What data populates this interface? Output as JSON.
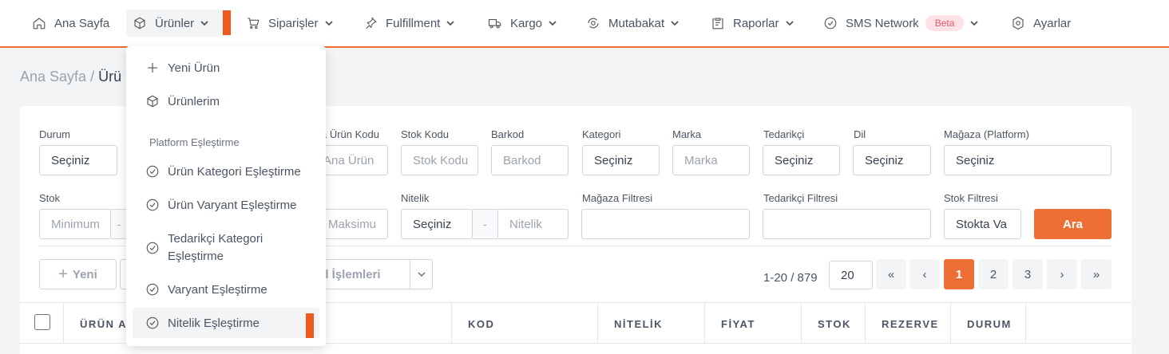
{
  "nav": {
    "home": "Ana Sayfa",
    "urunler": "Ürünler",
    "siparisler": "Siparişler",
    "fulfillment": "Fulfillment",
    "kargo": "Kargo",
    "mutabakat": "Mutabakat",
    "raporlar": "Raporlar",
    "sms": "SMS Network",
    "beta": "Beta",
    "ayarlar": "Ayarlar"
  },
  "breadcrumb": {
    "home": "Ana Sayfa",
    "sep": "/",
    "current": "Ürü"
  },
  "filters": {
    "durum": {
      "label": "Durum",
      "value": "Seçiniz"
    },
    "urun_kodu": {
      "label": "a Ürün Kodu",
      "placeholder": "Ana Ürün"
    },
    "stok_kodu": {
      "label": "Stok Kodu",
      "placeholder": "Stok Kodu"
    },
    "barkod": {
      "label": "Barkod",
      "placeholder": "Barkod"
    },
    "kategori": {
      "label": "Kategori",
      "value": "Seçiniz"
    },
    "marka": {
      "label": "Marka",
      "placeholder": "Marka"
    },
    "tedarikci": {
      "label": "Tedarikçi",
      "value": "Seçiniz"
    },
    "dil": {
      "label": "Dil",
      "value": "Seçiniz"
    },
    "magaza": {
      "label": "Mağaza (Platform)",
      "value": "Seçiniz"
    },
    "stok": {
      "label": "Stok",
      "min_placeholder": "Minimum",
      "sep": "-",
      "max_placeholder": "Maksimu"
    },
    "nitelik": {
      "label": "Nitelik",
      "value": "Seçiniz",
      "sep": "-",
      "placeholder": "Nitelik"
    },
    "magaza_filtresi": {
      "label": "Mağaza Filtresi"
    },
    "tedarikci_filtresi": {
      "label": "Tedarikçi Filtresi"
    },
    "stok_filtresi": {
      "label": "Stok Filtresi",
      "value": "Stokta Va"
    },
    "search_button": "Ara"
  },
  "actions": {
    "yeni": "Yeni",
    "toplu": "el İşlemleri"
  },
  "pagination": {
    "count": "1-20 / 879",
    "page_size": "20",
    "first": "«",
    "prev": "‹",
    "pages": [
      "1",
      "2",
      "3"
    ],
    "next": "›",
    "last": "»",
    "active_page": "1"
  },
  "table": {
    "headers": [
      "ÜRÜN AI",
      "KOD",
      "NİTELİK",
      "FİYAT",
      "STOK",
      "REZERVE",
      "DURUM"
    ]
  },
  "dropdown": {
    "yeni_urun": "Yeni Ürün",
    "urunlerim": "Ürünlerim",
    "section": "Platform Eşleştirme",
    "kategori_eslestirme": "Ürün Kategori Eşleştirme",
    "varyant_eslestirme": "Ürün Varyant Eşleştirme",
    "tedarikci_kategori_1": "Tedarikçi Kategori",
    "tedarikci_kategori_2": "Eşleştirme",
    "varyant": "Varyant Eşleştirme",
    "nitelik": "Nitelik Eşleştirme"
  },
  "colors": {
    "accent": "#ee6f35",
    "marker": "#ee5a1e"
  }
}
